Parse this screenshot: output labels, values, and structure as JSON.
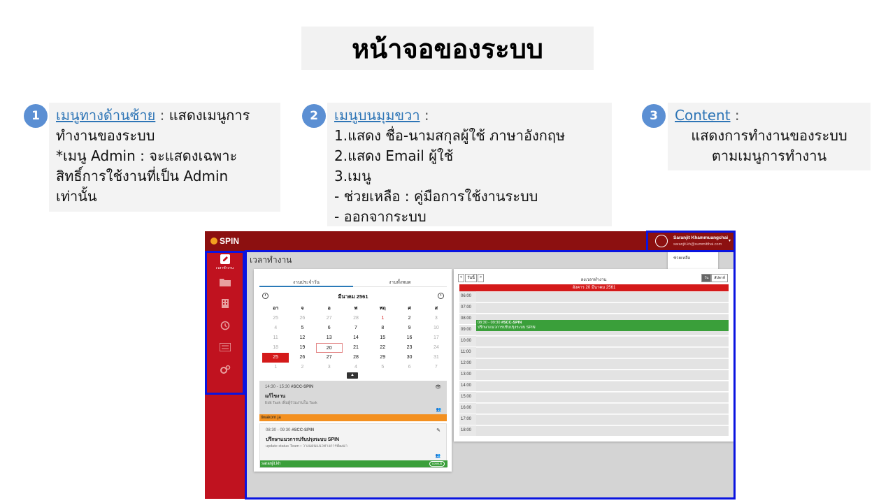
{
  "slide": {
    "title": "หน้าจอของระบบ"
  },
  "notes": [
    {
      "number": "1",
      "heading": "เมนูทางด้านซ้าย",
      "sep": " : ",
      "lines": [
        "แสดงเมนูการ",
        "ทำงานของระบบ",
        "*เมนู Admin : จะแสดงเฉพาะ",
        "สิทธิ์การใช้งานที่เป็น Admin",
        "เท่านั้น"
      ]
    },
    {
      "number": "2",
      "heading": "เมนูบนมุมขวา",
      "sep": " :",
      "lines": [
        "1.แสดง ชื่อ-นามสกุลผู้ใช้ ภาษาอังกฤษ",
        "2.แสดง Email ผู้ใช้",
        "3.เมนู",
        "- ช่วยเหลือ : คู่มือการใช้งานระบบ",
        "- ออกจากระบบ"
      ]
    },
    {
      "number": "3",
      "heading": "Content",
      "sep": " :",
      "lines": [
        "แสดงการทำงานของระบบ",
        "ตามเมนูการทำงาน"
      ]
    }
  ],
  "app": {
    "logo": "SPIN",
    "user": {
      "name": "Saranjit Khammuangchai",
      "email": "saranjit.kh@summitthai.com"
    },
    "user_menu": [
      "ช่วยเหลือ",
      "ออกจากระบบ"
    ],
    "sidebar": [
      {
        "icon": "pencil-icon",
        "label": "เวลาทำงาน"
      },
      {
        "icon": "folder-icon",
        "label": ""
      },
      {
        "icon": "building-icon",
        "label": ""
      },
      {
        "icon": "history-icon",
        "label": ""
      },
      {
        "icon": "list-icon",
        "label": ""
      },
      {
        "icon": "gears-icon",
        "label": ""
      }
    ],
    "page_title": "เวลาทำงาน",
    "tabs": [
      "งานประจำวัน",
      "งานทั้งหมด"
    ],
    "calendar": {
      "month": "มีนาคม 2561",
      "dow": [
        "อา",
        "จ",
        "อ",
        "พ",
        "พฤ",
        "ศ",
        "ส"
      ],
      "days": [
        [
          "25",
          "26",
          "27",
          "28",
          "1",
          "2",
          "3"
        ],
        [
          "4",
          "5",
          "6",
          "7",
          "8",
          "9",
          "10"
        ],
        [
          "11",
          "12",
          "13",
          "14",
          "15",
          "16",
          "17"
        ],
        [
          "18",
          "19",
          "20",
          "21",
          "22",
          "23",
          "24"
        ],
        [
          "25",
          "26",
          "27",
          "28",
          "29",
          "30",
          "31"
        ],
        [
          "1",
          "2",
          "3",
          "4",
          "5",
          "6",
          "7"
        ]
      ]
    },
    "tasks": [
      {
        "time": "14:30 - 15:30",
        "tag": "#SCC-SPIN",
        "title": "แก้ไขงาน",
        "desc": "Edit Task เพิ่มผู้ร่วมงานใน Task",
        "user": "tiwakorn.ja"
      },
      {
        "time": "08:30 - 09:30",
        "tag": "#SCC-SPIN",
        "title": "ปรึกษาแนวการปรับปรุงระบบ SPIN",
        "desc": "update status Team • วางแผนแนวทางการพัฒนา",
        "user": "saranjit.kh",
        "badge": "consult"
      }
    ],
    "schedule": {
      "nav": [
        "<",
        "วันนี้",
        ">"
      ],
      "title": "ลงเวลาทำงาน",
      "views": [
        "วัน",
        "สัปดาห์"
      ],
      "date": "อังคาร 20 มีนาคม 2561",
      "hours": [
        "06:00",
        "07:00",
        "08:00",
        "09:00",
        "10:00",
        "11:00",
        "12:00",
        "13:00",
        "14:00",
        "15:00",
        "16:00",
        "17:00",
        "18:00"
      ],
      "event": {
        "time": "08:30 - 09:30",
        "tag": "#SCC-SPIN",
        "title": "ปรึกษาแนวการปรับปรุงระบบ SPIN"
      }
    }
  },
  "colors": {
    "topbar": "#8c1010",
    "sidebar": "#c0121f",
    "highlight": "#0a14e0",
    "badge": "#5b8fd3"
  }
}
